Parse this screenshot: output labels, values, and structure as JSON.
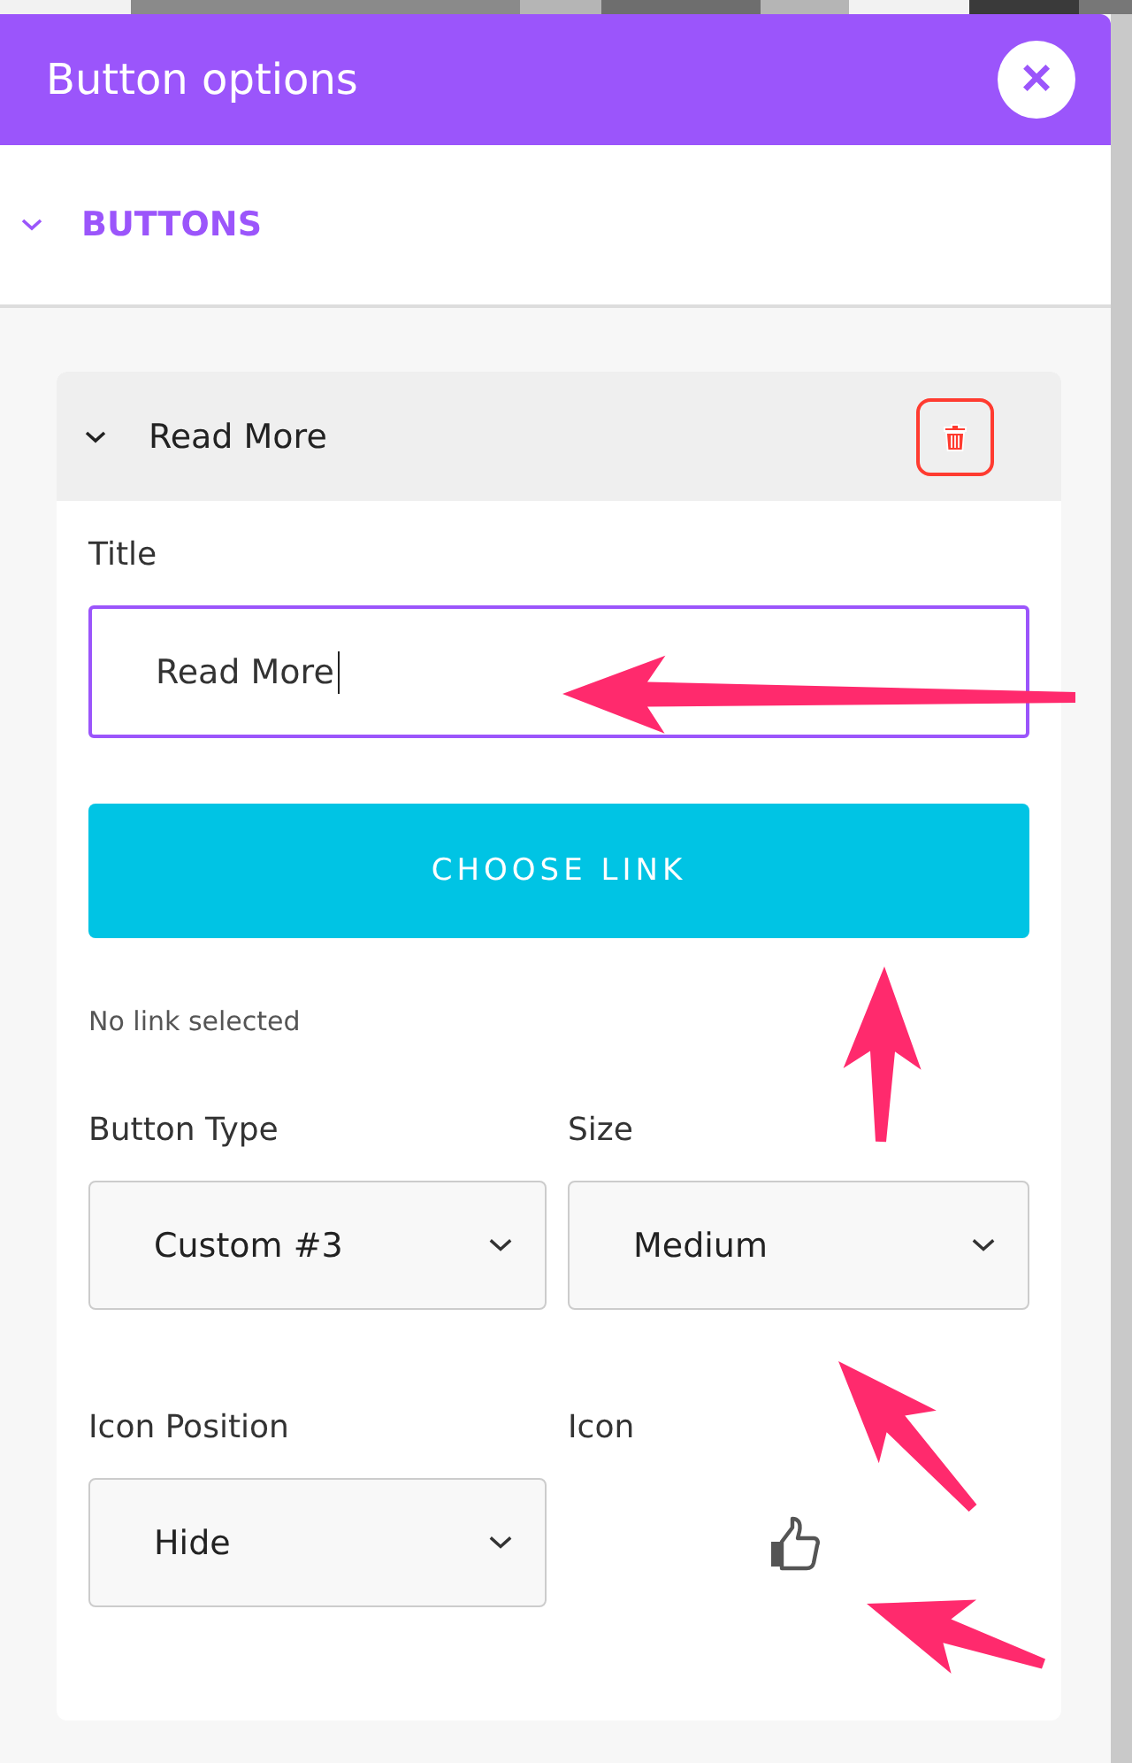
{
  "dialog": {
    "title": "Button options",
    "close": "×"
  },
  "section": {
    "label": "BUTTONS",
    "expanded": true
  },
  "item": {
    "title": "Read More",
    "expanded": true
  },
  "title_field": {
    "label": "Title",
    "value": "Read More",
    "focused": true
  },
  "link_button": {
    "label": "CHOOSE LINK"
  },
  "link_status": "No link selected",
  "selects": [
    {
      "label": "Button Type",
      "value": "Custom #3"
    },
    {
      "label": "Size",
      "value": "Medium"
    },
    {
      "label": "Icon Position",
      "value": "Hide"
    }
  ],
  "icon_field": {
    "label": "Icon"
  }
}
